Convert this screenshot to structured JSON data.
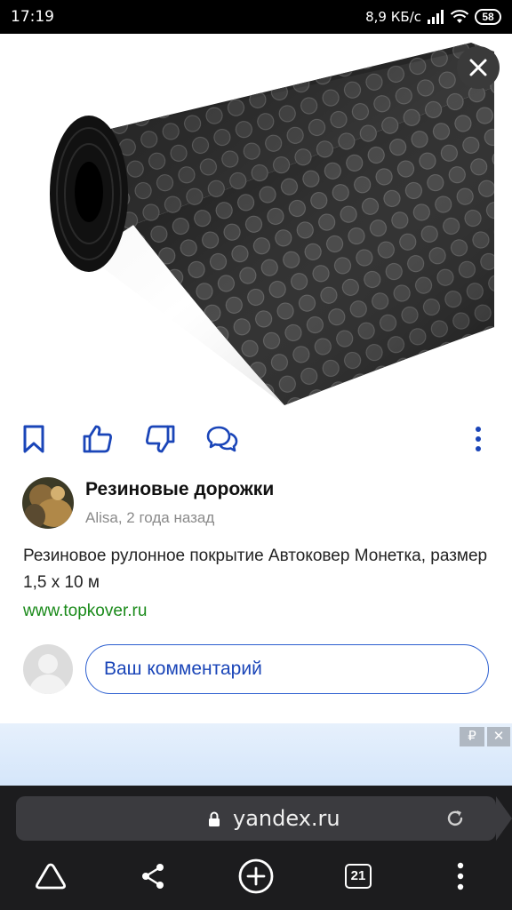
{
  "status_bar": {
    "time": "17:19",
    "network_speed": "8,9 КБ/с",
    "battery": "58"
  },
  "colors": {
    "accent_blue": "#1a45b8",
    "link_green": "#1a8a1a",
    "browser_bg": "#1c1c1e"
  },
  "icons": {
    "close": "close-icon",
    "bookmark": "bookmark-icon",
    "like": "thumbs-up-icon",
    "dislike": "thumbs-down-icon",
    "comments": "comments-icon",
    "more": "more-vertical-icon",
    "lock": "lock-icon",
    "reload": "reload-icon",
    "alice": "alice-icon",
    "share": "share-icon",
    "new_tab": "plus-circle-icon",
    "menu": "menu-icon"
  },
  "post": {
    "title": "Резиновые дорожки",
    "meta": "Alisa, 2 года назад",
    "description": "Резиновое рулонное покрытие Автоковер Монетка, размер 1,5 х 10 м",
    "link": "www.topkover.ru"
  },
  "comment": {
    "placeholder": "Ваш комментарий"
  },
  "ad": {
    "currency_badge": "₽",
    "close_badge": "✕"
  },
  "browser": {
    "url": "yandex.ru",
    "tabs_count": "21"
  }
}
